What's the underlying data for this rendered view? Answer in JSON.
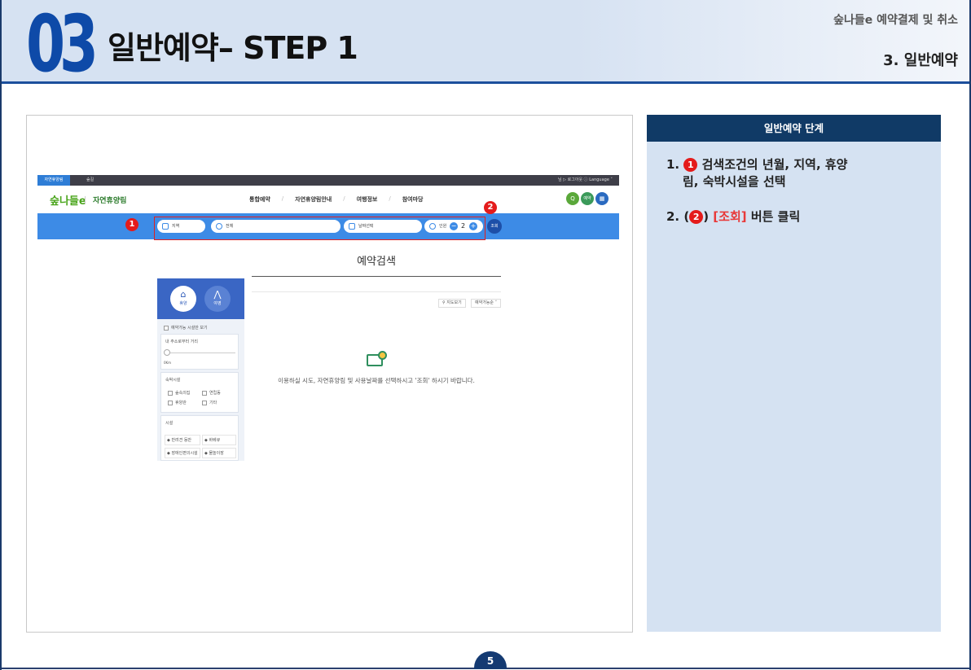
{
  "header": {
    "number": "03",
    "title": "일반예약– STEP 1",
    "top_right": "숲나들e 예약결제 및 취소",
    "section": "3. 일반예약"
  },
  "shot": {
    "topbar": {
      "tab_active": "자연휴양림",
      "tab_other": "숲길",
      "util": "님  ▷ 로그아웃  ⓘ Language ˅"
    },
    "nav": {
      "logo": "숲나들e",
      "site": "자연휴양림",
      "menu": [
        "통합예약",
        "자연휴양림안내",
        "여행정보",
        "참여마당"
      ],
      "slash": "/",
      "circles": [
        "Q",
        "예약",
        "▦"
      ]
    },
    "search": {
      "region": "지역",
      "all": "전체",
      "date": "날짜선택",
      "people_label": "인원",
      "minus": "−",
      "count": "2",
      "plus": "+",
      "search_btn": "조회",
      "badge1": "1",
      "badge2": "2"
    },
    "page_title": "예약검색",
    "left_panel": {
      "tab1": "휴양",
      "tab2": "야영",
      "avail_only": "예약가능 시설만 보기",
      "distance_label": "내 주소로부터 거리",
      "distance_val": "0Km",
      "lodging_label": "숙박시설",
      "lodging_items": [
        "숲속의집",
        "연립동",
        "휴양관",
        "기타"
      ],
      "facility_label": "시설",
      "facility_items": [
        "반려견 동반",
        "바베큐",
        "장애인편의시설",
        "물놀이장"
      ]
    },
    "map_view": "지도보기",
    "sort": "예약가능순 ˅",
    "empty_msg": "이용하실 시도, 자연휴양림 및 사용날짜를 선택하시고 '조회' 하시기 바랍니다."
  },
  "panel": {
    "heading": "일반예약 단계",
    "step1_prefix": "1.",
    "step1_badge": "1",
    "step1_text_a": "검색조건의 년월, 지역, 휴양",
    "step1_text_b": "림, 숙박시설을 선택",
    "step2_prefix": "2. (",
    "step2_badge": "2",
    "step2_mid": ") ",
    "step2_red": "[조회]",
    "step2_text": " 버튼 클릭"
  },
  "page_number": "5"
}
